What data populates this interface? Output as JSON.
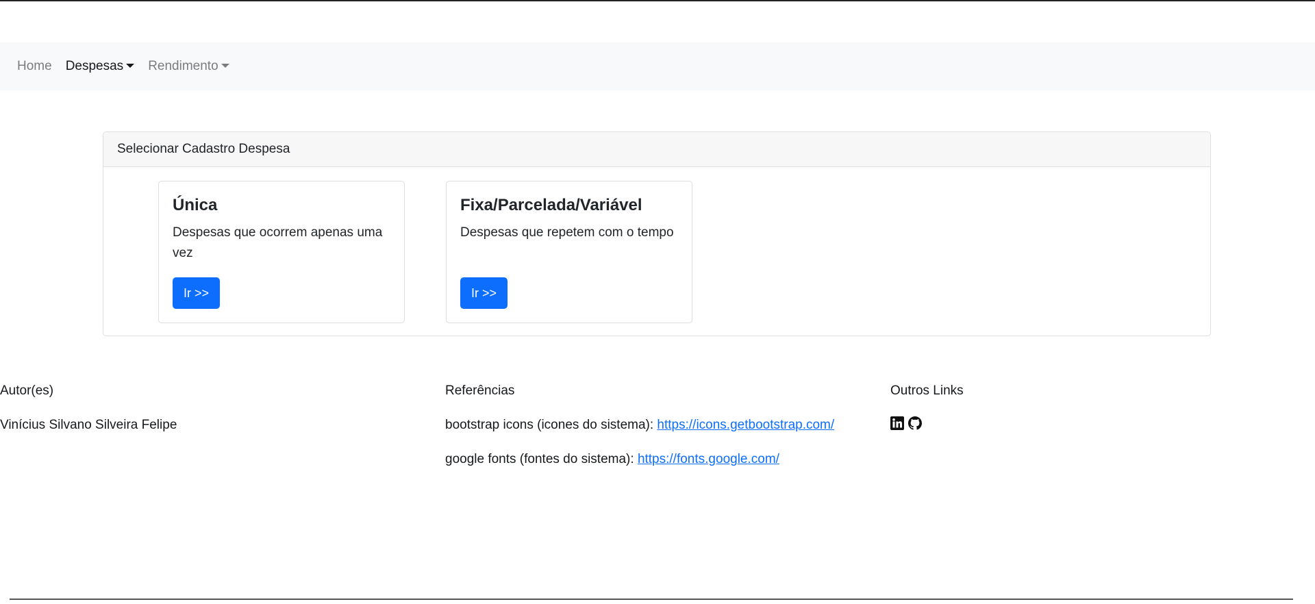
{
  "nav": {
    "items": [
      {
        "label": "Home"
      },
      {
        "label": "Despesas"
      },
      {
        "label": "Rendimento"
      }
    ]
  },
  "panel": {
    "header": "Selecionar Cadastro Despesa",
    "cards": [
      {
        "title": "Única",
        "text": "Despesas que ocorrem apenas uma vez",
        "button": "Ir >>"
      },
      {
        "title": "Fixa/Parcelada/Variável",
        "text": "Despesas que repetem com o tempo",
        "button": "Ir >>"
      }
    ]
  },
  "footer": {
    "authors": {
      "heading": "Autor(es)",
      "name": "Vinícius Silvano Silveira Felipe"
    },
    "references": {
      "heading": "Referências",
      "items": [
        {
          "text": "bootstrap icons (icones do sistema): ",
          "link": "https://icons.getbootstrap.com/"
        },
        {
          "text": "google fonts (fontes do sistema): ",
          "link": "https://fonts.google.com/"
        }
      ]
    },
    "other": {
      "heading": "Outros Links",
      "icons": [
        "linkedin-icon",
        "github-icon"
      ]
    }
  }
}
